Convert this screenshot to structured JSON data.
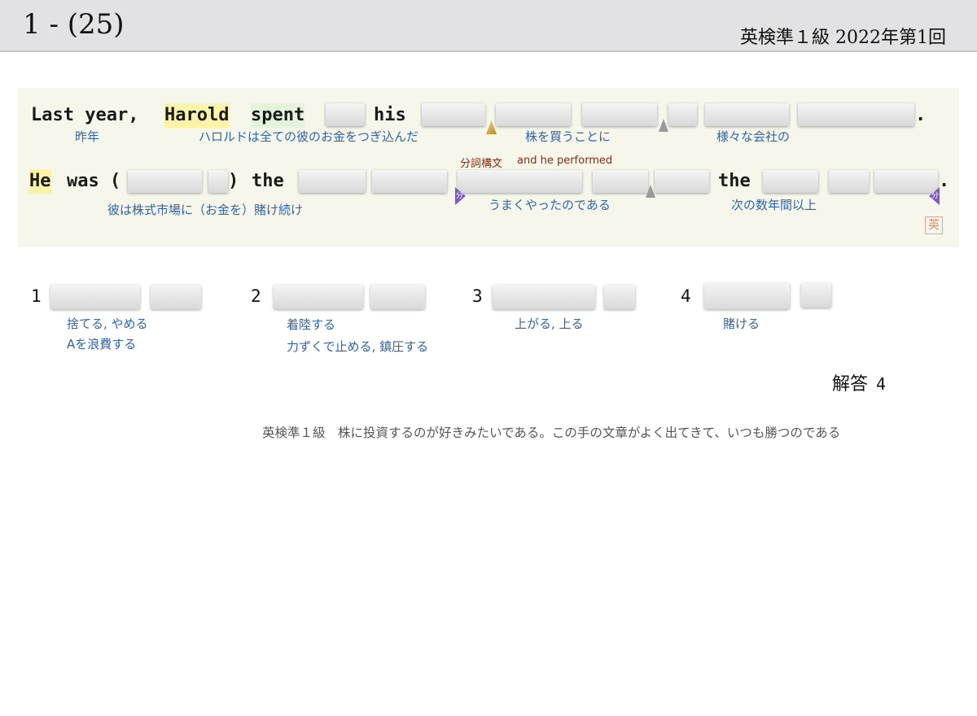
{
  "header": {
    "question_number": "1 - (25)",
    "exam_title": "英検準１級 2022年第1回"
  },
  "sentence": {
    "line1": {
      "w1": "Last year,",
      "w2": "Harold",
      "w3": "spent",
      "w4": "his",
      "period": "."
    },
    "line2": {
      "w1": "He",
      "w2": "was (",
      "w3": ")",
      "w4": "the",
      "w5": "the",
      "period": "."
    },
    "glosses": {
      "last_year": "昨年",
      "harold_spent": "ハロルドは全ての彼のお金をつぎ込んだ",
      "buying_stock": "株を買うことに",
      "various_companies": "様々な会社の",
      "was_betting": "彼は株式市場に（お金を）賭け続け",
      "did_well": "うまくやったのである",
      "next_years": "次の数年間以上"
    },
    "notes": {
      "participle": "分詞構文",
      "and_he_performed": "and he performed"
    },
    "markers": {
      "participle_short": "分"
    }
  },
  "options": [
    {
      "number": "1",
      "glosses": [
        "捨てる, やめる",
        "Aを浪費する"
      ]
    },
    {
      "number": "2",
      "glosses": [
        "着陸する",
        "力ずくで止める, 鎮圧する"
      ]
    },
    {
      "number": "3",
      "glosses": [
        "上がる, 上る"
      ]
    },
    {
      "number": "4",
      "glosses": [
        "賭ける"
      ]
    }
  ],
  "answer": {
    "label": "解答",
    "value": "4"
  },
  "comment": "英検準１級　株に投資するのが好きみたいである。この手の文章がよく出てきて、いつも勝つのである",
  "icons": {
    "seal": "stamp-seal-icon"
  }
}
